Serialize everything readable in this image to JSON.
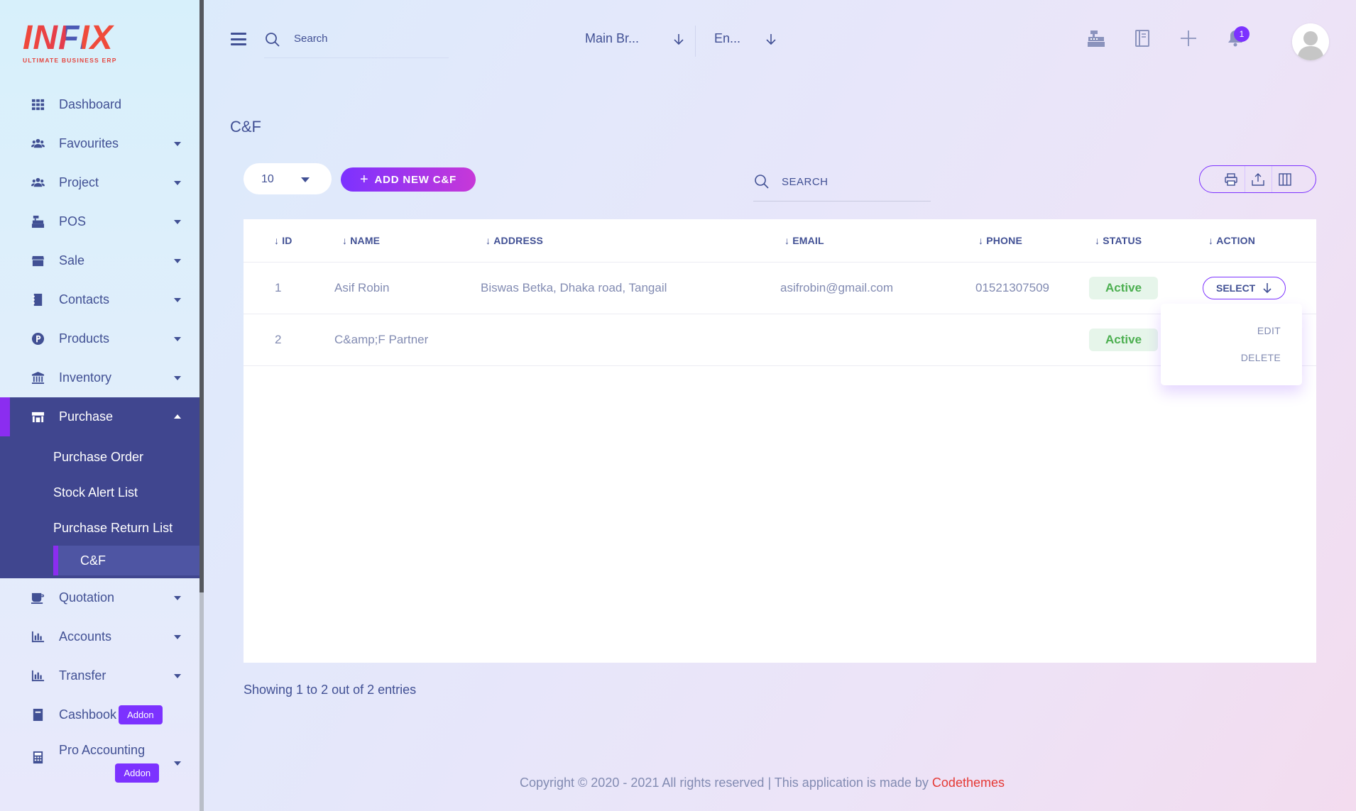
{
  "brand": {
    "logo_text": "INFIX",
    "tagline": "ULTIMATE BUSINESS ERP"
  },
  "sidebar": {
    "items": [
      {
        "label": "Dashboard",
        "icon": "grid-icon"
      },
      {
        "label": "Favourites",
        "icon": "users-icon"
      },
      {
        "label": "Project",
        "icon": "users-icon"
      },
      {
        "label": "POS",
        "icon": "cash-register-icon"
      },
      {
        "label": "Sale",
        "icon": "store-icon"
      },
      {
        "label": "Contacts",
        "icon": "contacts-icon"
      },
      {
        "label": "Products",
        "icon": "p-circle-icon"
      },
      {
        "label": "Inventory",
        "icon": "bank-icon"
      },
      {
        "label": "Purchase",
        "icon": "shop-icon"
      },
      {
        "label": "Quotation",
        "icon": "cup-icon"
      },
      {
        "label": "Accounts",
        "icon": "bar-chart-icon"
      },
      {
        "label": "Transfer",
        "icon": "bar-chart-icon"
      },
      {
        "label": "Cashbook",
        "icon": "book-icon",
        "badge": "Addon"
      },
      {
        "label": "Pro Accounting",
        "icon": "calculator-icon",
        "badge": "Addon"
      }
    ],
    "purchase_submenu": [
      "Purchase Order",
      "Stock Alert List",
      "Purchase Return List",
      "C&F"
    ]
  },
  "topbar": {
    "search_placeholder": "Search",
    "branch": "Main Br...",
    "language": "En...",
    "notification_count": "1"
  },
  "page": {
    "title": "C&F",
    "page_length": "10",
    "add_button": "ADD NEW C&F",
    "table_search_placeholder": "SEARCH",
    "columns": [
      "ID",
      "NAME",
      "ADDRESS",
      "EMAIL",
      "PHONE",
      "STATUS",
      "ACTION"
    ],
    "rows": [
      {
        "id": "1",
        "name": "Asif Robin",
        "address": "Biswas Betka, Dhaka road, Tangail",
        "email": "asifrobin@gmail.com",
        "phone": "01521307509",
        "status": "Active"
      },
      {
        "id": "2",
        "name": "C&amp;F Partner",
        "address": "",
        "email": "",
        "phone": "",
        "status": "Active"
      }
    ],
    "action_button": "SELECT",
    "action_menu": [
      "EDIT",
      "DELETE"
    ],
    "entries_info": "Showing 1 to 2 out of 2 entries"
  },
  "footer": {
    "text": "Copyright © 2020 - 2021 All rights reserved | This application is made by",
    "brand": "Codethemes"
  },
  "colors": {
    "primary": "#415094",
    "accent": "#7c32ff",
    "active_status": "#4caf50",
    "footer_brand": "#e53935"
  }
}
